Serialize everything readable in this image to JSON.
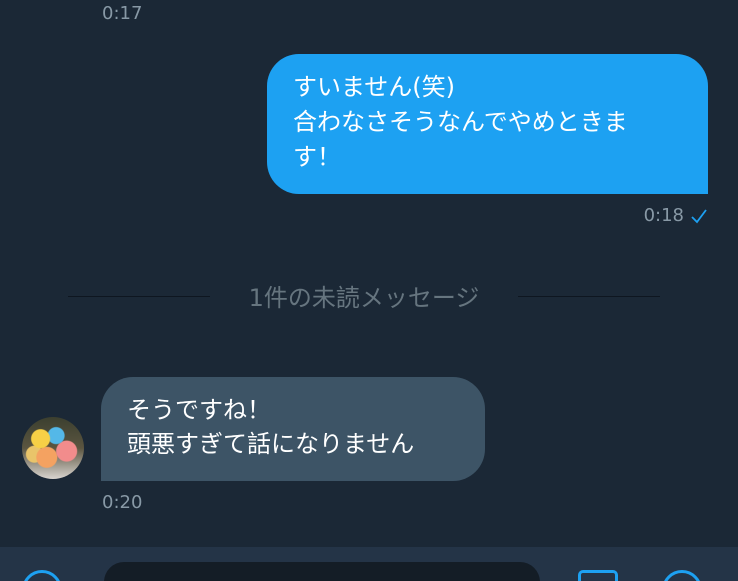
{
  "thread": {
    "prev_timestamp": "0:17",
    "outgoing": {
      "text": "すいません(笑)\n合わなさそうなんでやめときま\nす！",
      "timestamp": "0:18",
      "status_icon": "check-icon"
    },
    "unread_divider": "1件の未読メッセージ",
    "incoming": {
      "text": "そうですね！\n頭悪すぎて話になりません",
      "timestamp": "0:20",
      "avatar_icon": "avatar"
    }
  },
  "colors": {
    "background": "#1b2836",
    "outgoing_bubble": "#1da1f2",
    "incoming_bubble": "#3d5466",
    "secondary_text": "#8899a6",
    "accent": "#1da1f2"
  }
}
